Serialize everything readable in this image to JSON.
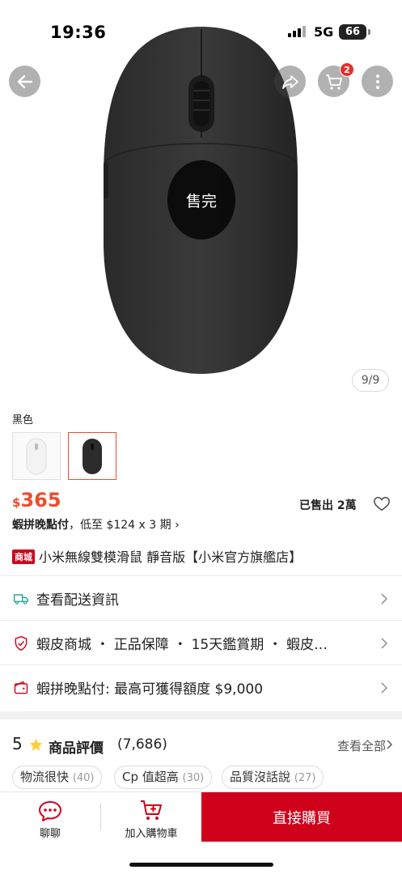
{
  "status_bar": {
    "time": "19:36",
    "network": "5G",
    "battery": "66"
  },
  "hero": {
    "cart_badge": "2",
    "sold_out_label": "售完",
    "image_counter": "9/9",
    "icons": [
      "back-arrow-icon",
      "share-icon",
      "cart-icon",
      "more-icon"
    ]
  },
  "variant": {
    "label": "黑色",
    "options": [
      {
        "name": "white-mouse-thumb",
        "selected": false
      },
      {
        "name": "black-mouse-thumb",
        "selected": true
      }
    ]
  },
  "price": {
    "currency": "$",
    "amount": "365",
    "sold_text": "已售出 2萬"
  },
  "installment": {
    "label": "蝦拼晚點付",
    "text": "，低至 $124 x 3 期",
    "arrow": "›"
  },
  "product": {
    "badge": "商城",
    "title": "小米無線雙模滑鼠 靜音版【小米官方旗艦店】"
  },
  "info_rows": [
    {
      "icon": "truck-icon",
      "text": "查看配送資訊"
    },
    {
      "icon": "shield-icon",
      "text": "蝦皮商城 ・ 正品保障 ・ 15天鑑賞期 ・ 蝦皮…"
    },
    {
      "icon": "wallet-icon",
      "text": "蝦拼晚點付: 最高可獲得額度 $9,000"
    }
  ],
  "rating": {
    "score": "5",
    "title": "商品評價",
    "count": "(7,686)",
    "view_all": "查看全部"
  },
  "review_tags": [
    {
      "label": "物流很快",
      "count": "(40)"
    },
    {
      "label": "Cp 值超高",
      "count": "(30)"
    },
    {
      "label": "品質沒話說",
      "count": "(27)"
    }
  ],
  "bottom_bar": {
    "chat_label": "聊聊",
    "cart_label": "加入購物車",
    "buy_label": "直接購買"
  },
  "colors": {
    "accent": "#ee4d2d",
    "buy_button": "#d0011b",
    "badge": "#e4302a"
  }
}
